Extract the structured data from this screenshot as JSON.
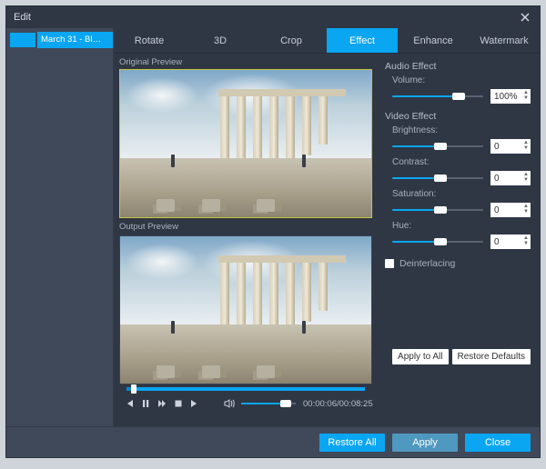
{
  "window": {
    "title": "Edit"
  },
  "sidebar": {
    "items": [
      {
        "label": "March 31 - Bl…"
      }
    ]
  },
  "tabs": [
    {
      "label": "Rotate"
    },
    {
      "label": "3D"
    },
    {
      "label": "Crop"
    },
    {
      "label": "Effect"
    },
    {
      "label": "Enhance"
    },
    {
      "label": "Watermark"
    }
  ],
  "preview": {
    "original_label": "Original Preview",
    "output_label": "Output Preview"
  },
  "audio_effect": {
    "label": "Audio Effect",
    "volume_label": "Volume:",
    "volume_value": "100%",
    "volume_pct": 70
  },
  "video_effect": {
    "label": "Video Effect",
    "brightness_label": "Brightness:",
    "brightness_value": "0",
    "brightness_pct": 50,
    "contrast_label": "Contrast:",
    "contrast_value": "0",
    "contrast_pct": 50,
    "saturation_label": "Saturation:",
    "saturation_value": "0",
    "saturation_pct": 50,
    "hue_label": "Hue:",
    "hue_value": "0",
    "hue_pct": 50
  },
  "deinterlacing": {
    "label": "Deinterlacing",
    "checked": false
  },
  "buttons": {
    "apply_to_all": "Apply to All",
    "restore_defaults": "Restore Defaults",
    "restore_all": "Restore All",
    "apply": "Apply",
    "close": "Close"
  },
  "playback": {
    "position_pct": 2,
    "volume_pct": 75,
    "elapsed": "00:00:06",
    "total": "00:08:25"
  }
}
